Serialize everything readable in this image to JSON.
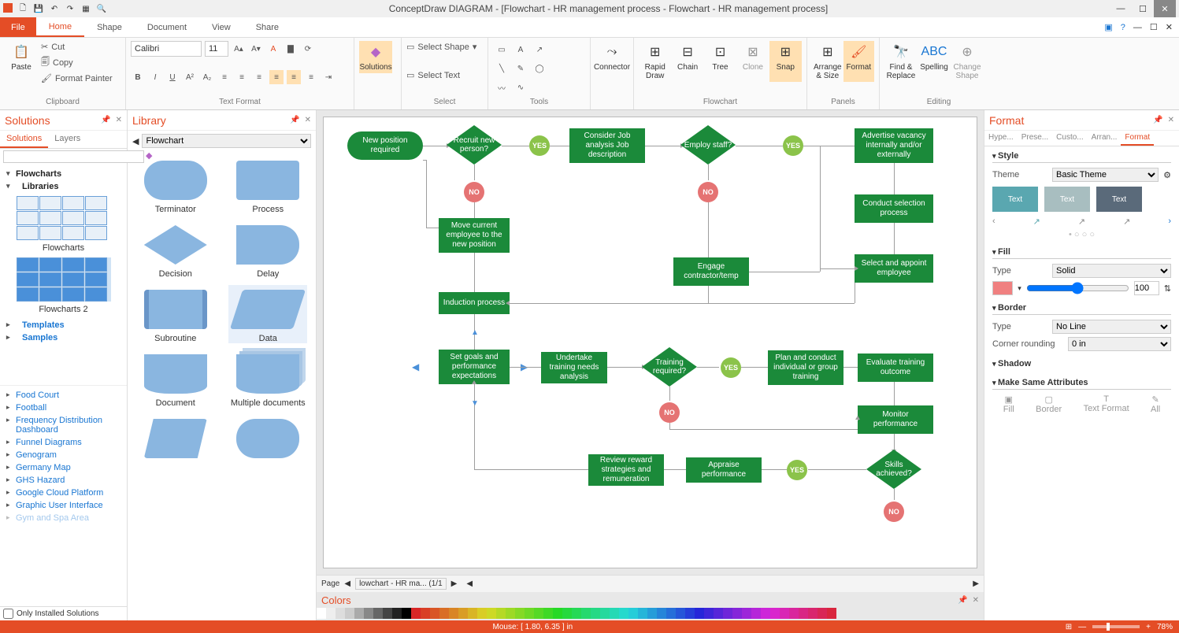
{
  "titlebar": {
    "title": "ConceptDraw DIAGRAM - [Flowchart - HR management process - Flowchart - HR management process]"
  },
  "menubar": {
    "file": "File",
    "tabs": [
      "Home",
      "Shape",
      "Document",
      "View",
      "Share"
    ],
    "active": 0
  },
  "ribbon": {
    "clipboard": {
      "paste": "Paste",
      "cut": "Cut",
      "copy": "Copy",
      "painter": "Format Painter",
      "label": "Clipboard"
    },
    "text": {
      "font": "Calibri",
      "size": "11",
      "label": "Text Format"
    },
    "solutions": {
      "btn": "Solutions"
    },
    "select": {
      "shape": "Select Shape",
      "text": "Select Text",
      "label": "Select"
    },
    "tools": {
      "connector": "Connector",
      "label": "Tools"
    },
    "flowchart": {
      "rapid": "Rapid Draw",
      "chain": "Chain",
      "tree": "Tree",
      "clone": "Clone",
      "snap": "Snap",
      "label": "Flowchart"
    },
    "panels": {
      "arrange": "Arrange & Size",
      "format": "Format",
      "label": "Panels"
    },
    "editing": {
      "find": "Find & Replace",
      "spell": "Spelling",
      "change": "Change Shape",
      "label": "Editing"
    }
  },
  "solutions_panel": {
    "title": "Solutions",
    "tabs": [
      "Solutions",
      "Layers"
    ],
    "tree": {
      "root": "Flowcharts",
      "libraries": "Libraries",
      "set1": "Flowcharts",
      "set2": "Flowcharts 2",
      "templates": "Templates",
      "samples": "Samples"
    },
    "cats": [
      "Food Court",
      "Football",
      "Frequency Distribution Dashboard",
      "Funnel Diagrams",
      "Genogram",
      "Germany Map",
      "GHS Hazard",
      "Google Cloud Platform",
      "Graphic User Interface",
      "Gym and Spa Area"
    ],
    "footer": "Only Installed Solutions"
  },
  "library_panel": {
    "title": "Library",
    "combo": "Flowchart",
    "shapes": [
      "Terminator",
      "Process",
      "Decision",
      "Delay",
      "Subroutine",
      "Data",
      "Document",
      "Multiple documents"
    ]
  },
  "canvas": {
    "nodes": {
      "new_pos": "New position required",
      "recruit": "Recruit new person?",
      "consider": "Consider Job analysis Job description",
      "employ": "Employ staff?",
      "advertise": "Advertise vacancy internally and/or externally",
      "conduct_sel": "Conduct selection process",
      "move": "Move current employee to the new position",
      "engage": "Engage contractor/temp",
      "select_app": "Select and appoint employee",
      "induction": "Induction process",
      "set_goals": "Set goals and performance expectations",
      "undertake": "Undertake training needs analysis",
      "training": "Training required?",
      "plan": "Plan and conduct individual or group training",
      "evaluate": "Evaluate training outcome",
      "monitor": "Monitor performance",
      "skills": "Skills achieved?",
      "appraise": "Appraise performance",
      "review": "Review reward strategies and remuneration"
    },
    "yes": "YES",
    "no": "NO",
    "page_label": "Page",
    "page_tab": "lowchart - HR ma... (1/1"
  },
  "colors": {
    "title": "Colors"
  },
  "format": {
    "title": "Format",
    "tabs": [
      "Hype...",
      "Prese...",
      "Custo...",
      "Arran...",
      "Format"
    ],
    "style": "Style",
    "theme_lbl": "Theme",
    "theme_val": "Basic Theme",
    "fill": "Fill",
    "fill_type": "Type",
    "fill_val": "Solid",
    "fill_pct": "100",
    "border": "Border",
    "border_type": "Type",
    "border_val": "No Line",
    "corner": "Corner rounding",
    "corner_val": "0 in",
    "shadow": "Shadow",
    "same": "Make Same Attributes",
    "same_btns": [
      "Fill",
      "Border",
      "Text Format",
      "All"
    ],
    "text_sw": "Text"
  },
  "status": {
    "mouse": "Mouse: [ 1.80, 6.35 ] in",
    "zoom": "78%"
  }
}
